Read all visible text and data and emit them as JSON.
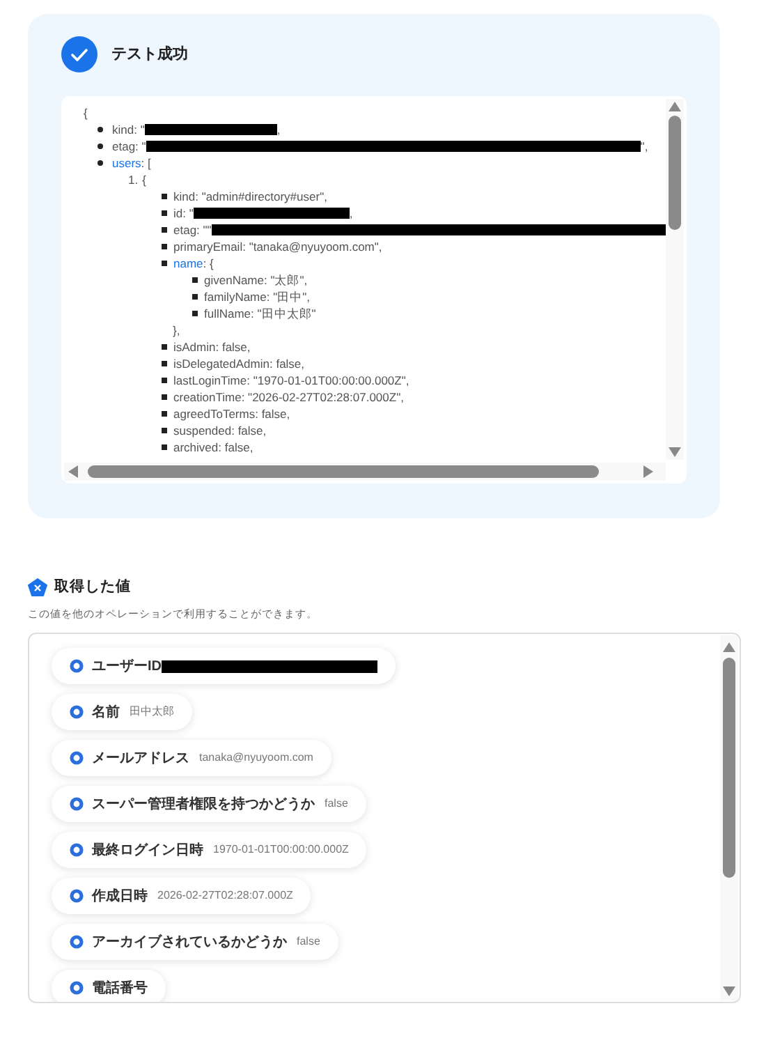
{
  "test_result": {
    "title": "テスト成功",
    "code": [
      {
        "kind": "plain",
        "text": "{",
        "children": [
          {
            "kind": "entry",
            "key": "kind",
            "value": ": \"",
            "highlight": false,
            "redaction": {
              "kind": "short"
            },
            "after": ","
          },
          {
            "kind": "entry",
            "key": "etag",
            "value": ": \"",
            "highlight": false,
            "redaction": {
              "kind": "long"
            },
            "after": "\","
          },
          {
            "kind": "entry",
            "key": "users",
            "value": ": [",
            "highlight": true,
            "children": [
              {
                "kind": "numbered",
                "marker": "1.",
                "text": "{",
                "children": [
                  {
                    "kind": "entry",
                    "key": "kind",
                    "value": ": \"admin#directory#user\",",
                    "highlight": false
                  },
                  {
                    "kind": "entry",
                    "key": "id",
                    "value": ": \"",
                    "highlight": false,
                    "redaction": {
                      "kind": "medium"
                    },
                    "after": ","
                  },
                  {
                    "kind": "entry",
                    "key": "etag",
                    "value": ": \"\"",
                    "highlight": false,
                    "redaction": {
                      "kind": "overflow"
                    }
                  },
                  {
                    "kind": "entry",
                    "key": "primaryEmail",
                    "value": ": \"tanaka@nyuyoom.com\",",
                    "highlight": false
                  },
                  {
                    "kind": "entry",
                    "key": "name",
                    "value": ": {",
                    "highlight": true,
                    "children": [
                      {
                        "kind": "entry",
                        "key": "givenName",
                        "value": ": \"太郎\",",
                        "highlight": false
                      },
                      {
                        "kind": "entry",
                        "key": "familyName",
                        "value": ": \"田中\",",
                        "highlight": false
                      },
                      {
                        "kind": "entry",
                        "key": "fullName",
                        "value": ": \"田中太郎\"",
                        "highlight": false
                      }
                    ]
                  },
                  {
                    "kind": "plain",
                    "text": "},"
                  },
                  {
                    "kind": "entry",
                    "key": "isAdmin",
                    "value": ": false,",
                    "highlight": false
                  },
                  {
                    "kind": "entry",
                    "key": "isDelegatedAdmin",
                    "value": ": false,",
                    "highlight": false
                  },
                  {
                    "kind": "entry",
                    "key": "lastLoginTime",
                    "value": ": \"1970-01-01T00:00:00.000Z\",",
                    "highlight": false
                  },
                  {
                    "kind": "entry",
                    "key": "creationTime",
                    "value": ": \"2026-02-27T02:28:07.000Z\",",
                    "highlight": false
                  },
                  {
                    "kind": "entry",
                    "key": "agreedToTerms",
                    "value": ": false,",
                    "highlight": false
                  },
                  {
                    "kind": "entry",
                    "key": "suspended",
                    "value": ": false,",
                    "highlight": false
                  },
                  {
                    "kind": "entry",
                    "key": "archived",
                    "value": ": false,",
                    "highlight": false
                  }
                ]
              }
            ]
          }
        ]
      }
    ]
  },
  "values": {
    "title": "取得した値",
    "description": "この値を他のオペレーションで利用することができます。",
    "items": [
      {
        "label": "ユーザーID",
        "redaction": {
          "kind": "wide"
        }
      },
      {
        "label": "名前",
        "value": "田中太郎"
      },
      {
        "label": "メールアドレス",
        "value": "tanaka@nyuyoom.com"
      },
      {
        "label": "スーパー管理者権限を持つかどうか",
        "value": "false"
      },
      {
        "label": "最終ログイン日時",
        "value": "1970-01-01T00:00:00.000Z"
      },
      {
        "label": "作成日時",
        "value": "2026-02-27T02:28:07.000Z"
      },
      {
        "label": "アーカイブされているかどうか",
        "value": "false"
      },
      {
        "label": "電話番号"
      }
    ]
  }
}
